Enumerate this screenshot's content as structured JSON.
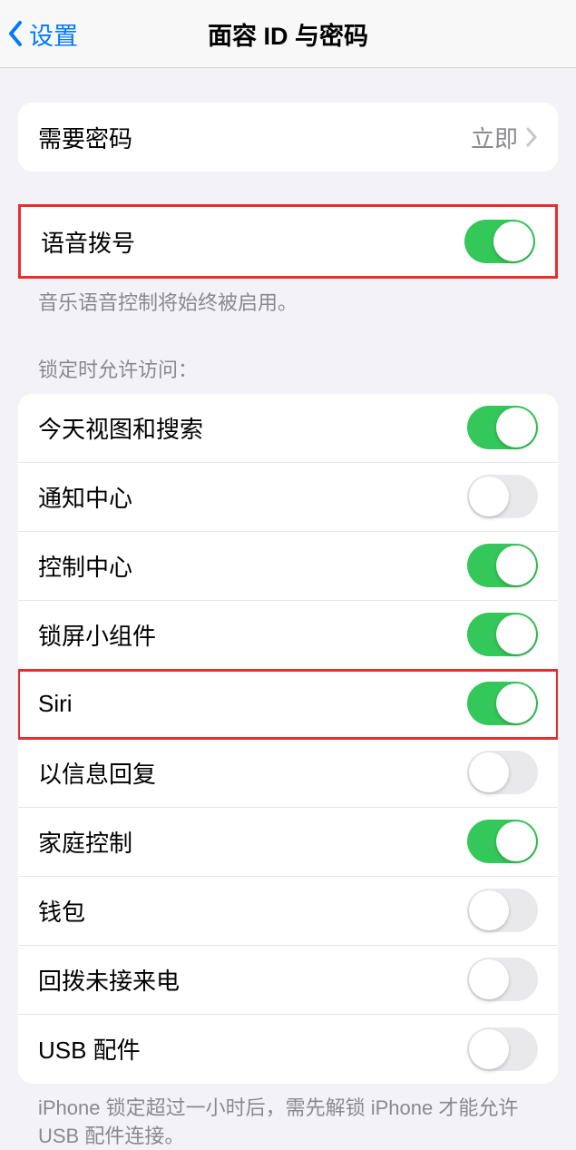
{
  "nav": {
    "back_label": "设置",
    "title": "面容 ID 与密码"
  },
  "require_passcode": {
    "label": "需要密码",
    "value": "立即"
  },
  "voice_dial": {
    "label": "语音拨号",
    "enabled": true,
    "footer": "音乐语音控制将始终被启用。"
  },
  "allow_access": {
    "header": "锁定时允许访问：",
    "items": [
      {
        "label": "今天视图和搜索",
        "enabled": true
      },
      {
        "label": "通知中心",
        "enabled": false
      },
      {
        "label": "控制中心",
        "enabled": true
      },
      {
        "label": "锁屏小组件",
        "enabled": true
      },
      {
        "label": "Siri",
        "enabled": true,
        "highlighted": true
      },
      {
        "label": "以信息回复",
        "enabled": false
      },
      {
        "label": "家庭控制",
        "enabled": true
      },
      {
        "label": "钱包",
        "enabled": false
      },
      {
        "label": "回拨未接来电",
        "enabled": false
      },
      {
        "label": "USB 配件",
        "enabled": false
      }
    ],
    "footer": "iPhone 锁定超过一小时后，需先解锁 iPhone 才能允许USB 配件连接。"
  }
}
